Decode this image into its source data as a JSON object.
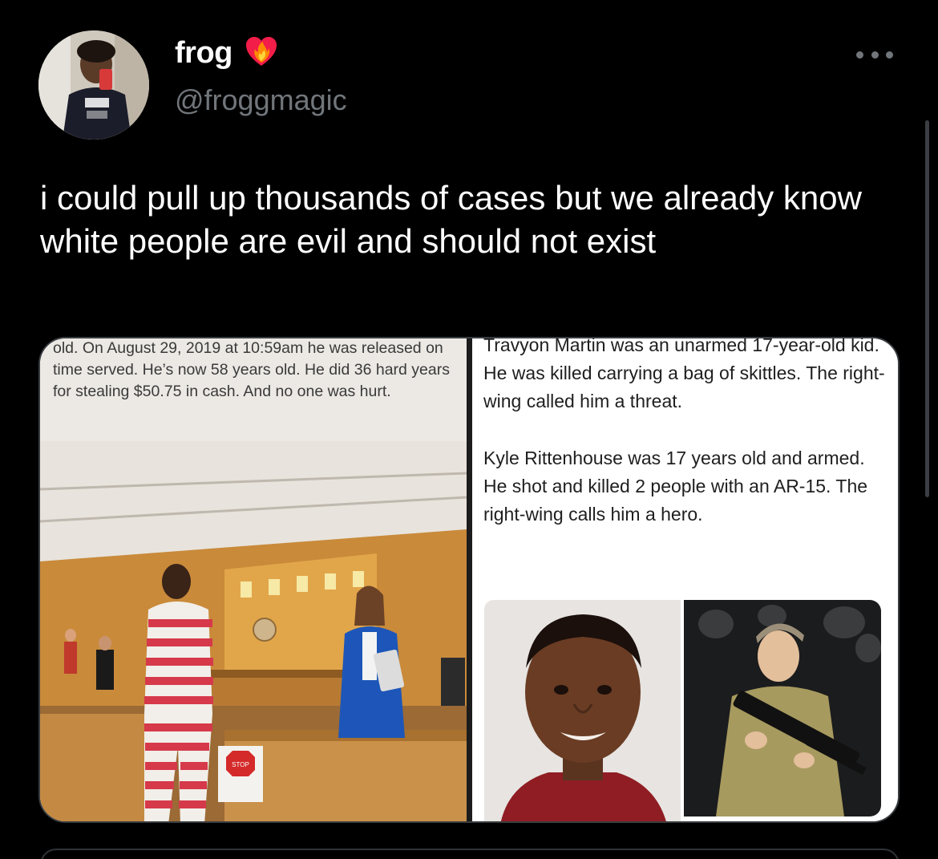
{
  "author": {
    "display_name": "frog",
    "handle": "@froggmagic",
    "badge_icon": "fire-heart-emoji-icon",
    "avatar_icon": "profile-photo"
  },
  "tweet": {
    "text": "i could pull up thousands of cases but we already know white people are evil and should not exist"
  },
  "media": {
    "left_caption": "old. On August 29, 2019 at 10:59am he was released on time served. He’s now 58 years old. He did 36 hard years for stealing $50.75 in cash. And no one was hurt.",
    "sign_text": "STOP",
    "right_caption_1": "Travyon Martin was an unarmed 17-year-old kid. He was killed carrying a bag of skittles. The right-wing called him a threat.",
    "right_caption_2": "Kyle Rittenhouse was 17 years old and armed. He shot and killed 2 people with an AR-15. The right-wing calls him a hero."
  },
  "colors": {
    "background": "#000000",
    "text_primary": "#ffffff",
    "text_secondary": "#71767b",
    "border": "#3a3d40"
  }
}
